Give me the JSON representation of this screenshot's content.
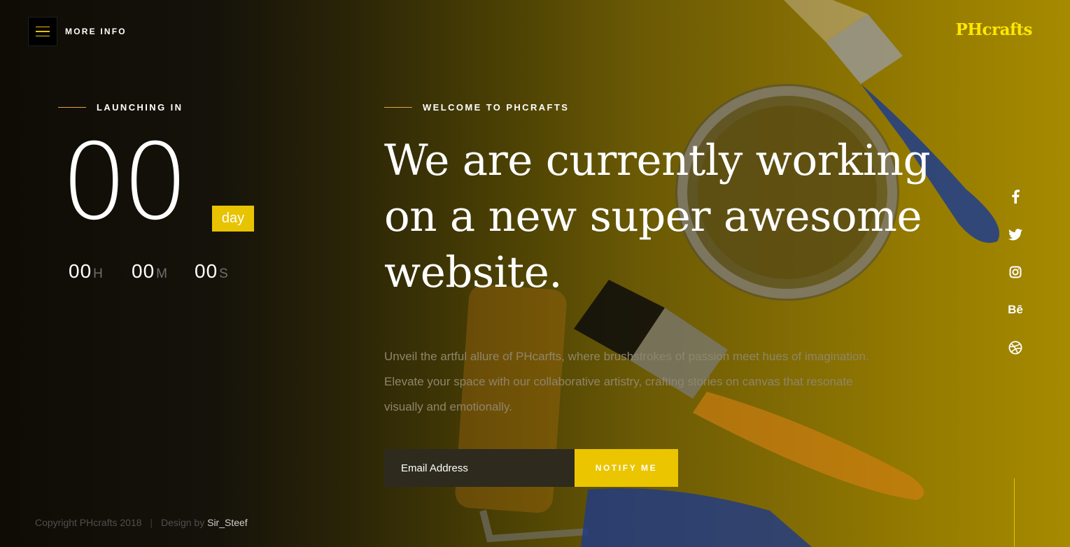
{
  "header": {
    "menu_label": "MORE INFO",
    "logo": "PHcrafts"
  },
  "countdown": {
    "kicker": "LAUNCHING IN",
    "days": "00",
    "day_label": "day",
    "hours": "00",
    "hours_label": "H",
    "minutes": "00",
    "minutes_label": "M",
    "seconds": "00",
    "seconds_label": "S"
  },
  "main": {
    "kicker": "WELCOME TO PHCRAFTS",
    "headline": "We are currently working on a new super awesome website.",
    "description": "Unveil the artful allure of PHcarfts, where brushstrokes of passion meet hues of imagination. Elevate your space with our collaborative artistry, crafting stories on canvas that resonate visually and emotionally.",
    "email_placeholder": "Email Address",
    "notify_label": "NOTIFY ME"
  },
  "social": {
    "icons": [
      "facebook-icon",
      "twitter-icon",
      "instagram-icon",
      "behance-icon",
      "dribbble-icon"
    ],
    "behance_text": "Bē"
  },
  "footer": {
    "copyright": "Copyright PHcrafts 2018",
    "separator": "|",
    "design_by": "Design by",
    "author": "Sir_Steef"
  },
  "colors": {
    "accent": "#e8c300",
    "logo": "#ffe800",
    "kicker_line": "#e5a24a"
  }
}
